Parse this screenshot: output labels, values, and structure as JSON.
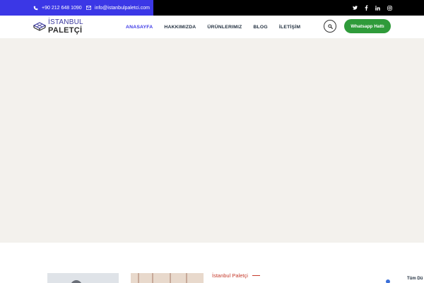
{
  "topbar": {
    "phone": "+90 212 648 1090",
    "email": "info@istanbulpaletci.com",
    "social_icons": [
      "twitter-icon",
      "facebook-icon",
      "linkedin-icon",
      "instagram-icon"
    ],
    "left_color": "#3b37e6",
    "right_color": "#000000"
  },
  "logo": {
    "line1": "İSTANBUL",
    "line2": "PALETÇİ"
  },
  "nav": {
    "items": [
      "ANASAYFA",
      "HAKKIMIZDA",
      "ÜRÜNLERIMIZ",
      "BLOG",
      "İLETİŞİM"
    ],
    "active_index": 0,
    "active_color": "#3b37e6"
  },
  "header": {
    "whatsapp_label": "Whatsapp Hattı",
    "whatsapp_color": "#2f9b3a"
  },
  "bottom": {
    "section_label": "İstanbul Paletçi",
    "corner_text": "Tüm Dü"
  }
}
